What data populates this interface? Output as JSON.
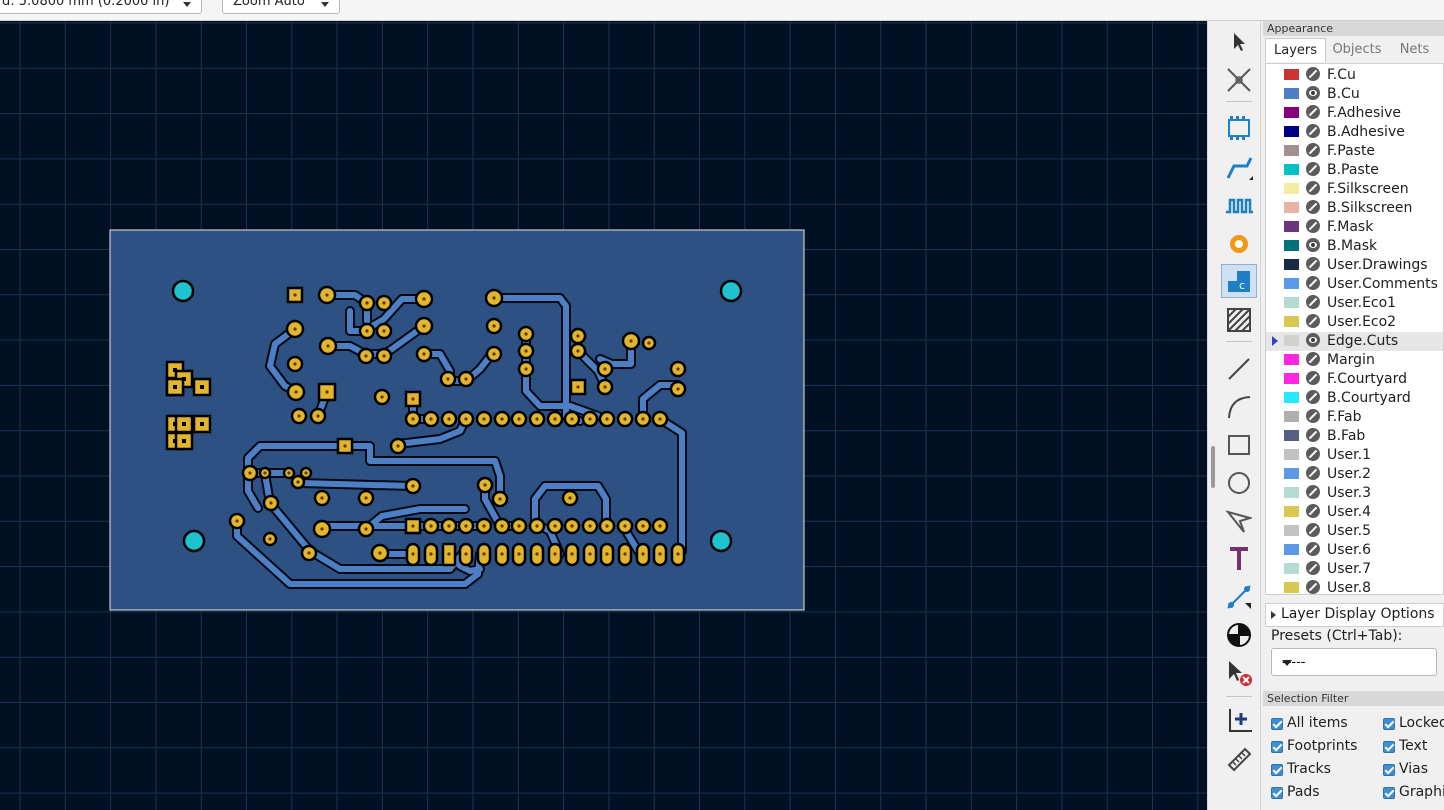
{
  "top_toolbar": {
    "grid_select": "d: 5.0800 mm (0.2000 in)",
    "zoom_select": "Zoom Auto"
  },
  "toolbar_icons": [
    "select-arrow-icon",
    "cross-probe-icon",
    "footprint-icon",
    "route-track-icon",
    "tune-length-icon",
    "via-icon",
    "rule-area-icon",
    "filled-zone-icon",
    "line-icon",
    "arc-icon",
    "rectangle-icon",
    "circle-icon",
    "polygon-icon",
    "text-icon",
    "dimension-icon",
    "origin-icon",
    "delete-icon",
    "grid-origin-icon",
    "measure-icon"
  ],
  "appearance": {
    "title": "Appearance",
    "tabs": [
      "Layers",
      "Objects",
      "Nets"
    ],
    "active_tab": "Layers",
    "layers": [
      {
        "name": "F.Cu",
        "color": "#c83434",
        "visible": false
      },
      {
        "name": "B.Cu",
        "color": "#4d7fc4",
        "visible": true
      },
      {
        "name": "F.Adhesive",
        "color": "#84007c",
        "visible": false
      },
      {
        "name": "B.Adhesive",
        "color": "#000084",
        "visible": false
      },
      {
        "name": "F.Paste",
        "color": "#a0908e",
        "visible": false
      },
      {
        "name": "B.Paste",
        "color": "#00c2c2",
        "visible": false
      },
      {
        "name": "F.Silkscreen",
        "color": "#f2eda1",
        "visible": false
      },
      {
        "name": "B.Silkscreen",
        "color": "#e8b2a7",
        "visible": false
      },
      {
        "name": "F.Mask",
        "color": "#6c357f",
        "visible": false
      },
      {
        "name": "B.Mask",
        "color": "#02727a",
        "visible": true
      },
      {
        "name": "User.Drawings",
        "color": "#192a45",
        "visible": false
      },
      {
        "name": "User.Comments",
        "color": "#5a99e5",
        "visible": false
      },
      {
        "name": "User.Eco1",
        "color": "#b4dbd2",
        "visible": false
      },
      {
        "name": "User.Eco2",
        "color": "#d8c852",
        "visible": false
      },
      {
        "name": "Edge.Cuts",
        "color": "#d0d2cd",
        "visible": true,
        "selected": true
      },
      {
        "name": "Margin",
        "color": "#ff26e2",
        "visible": false
      },
      {
        "name": "F.Courtyard",
        "color": "#ff26e2",
        "visible": false
      },
      {
        "name": "B.Courtyard",
        "color": "#26e9ff",
        "visible": false
      },
      {
        "name": "F.Fab",
        "color": "#afafaf",
        "visible": false
      },
      {
        "name": "B.Fab",
        "color": "#585d84",
        "visible": false
      },
      {
        "name": "User.1",
        "color": "#c2c2c2",
        "visible": false
      },
      {
        "name": "User.2",
        "color": "#5a99e5",
        "visible": false
      },
      {
        "name": "User.3",
        "color": "#b4dbd2",
        "visible": false
      },
      {
        "name": "User.4",
        "color": "#d8c852",
        "visible": false
      },
      {
        "name": "User.5",
        "color": "#c2c2c2",
        "visible": false
      },
      {
        "name": "User.6",
        "color": "#5a99e5",
        "visible": false
      },
      {
        "name": "User.7",
        "color": "#b4dbd2",
        "visible": false
      },
      {
        "name": "User.8",
        "color": "#d8c852",
        "visible": false
      }
    ],
    "layer_display_options": "Layer Display Options",
    "presets_label": "Presets (Ctrl+Tab):",
    "presets_value": "-----"
  },
  "selection_filter": {
    "title": "Selection Filter",
    "items": [
      {
        "label": "All items",
        "checked": true
      },
      {
        "label": "Locked",
        "checked": true
      },
      {
        "label": "Footprints",
        "checked": true
      },
      {
        "label": "Text",
        "checked": true
      },
      {
        "label": "Tracks",
        "checked": true
      },
      {
        "label": "Vias",
        "checked": true
      },
      {
        "label": "Pads",
        "checked": true
      },
      {
        "label": "Graphics",
        "checked": true
      }
    ]
  },
  "colors": {
    "canvas_bg": "#001023",
    "grid": "#1b3350",
    "board_fill": "#2e5183",
    "track": "#4d7fc4",
    "pad": "#e3b52c",
    "mounting_hole": "#1fc3cf"
  }
}
